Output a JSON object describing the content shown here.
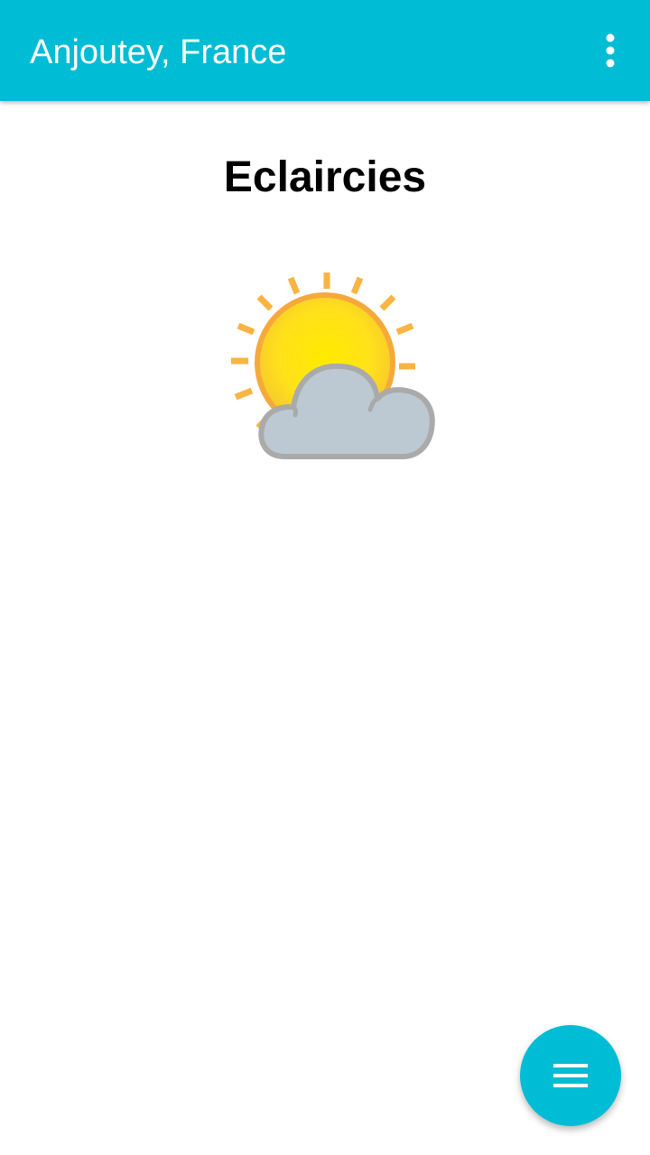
{
  "app_bar": {
    "title": "Anjoutey, France",
    "background_color": "#00BCD4",
    "overflow_icon": "more-vert-icon"
  },
  "weather": {
    "condition": "Eclaircies",
    "icon": "partly-sunny-icon"
  },
  "fab": {
    "icon": "menu-icon",
    "color": "#00BCD4"
  }
}
